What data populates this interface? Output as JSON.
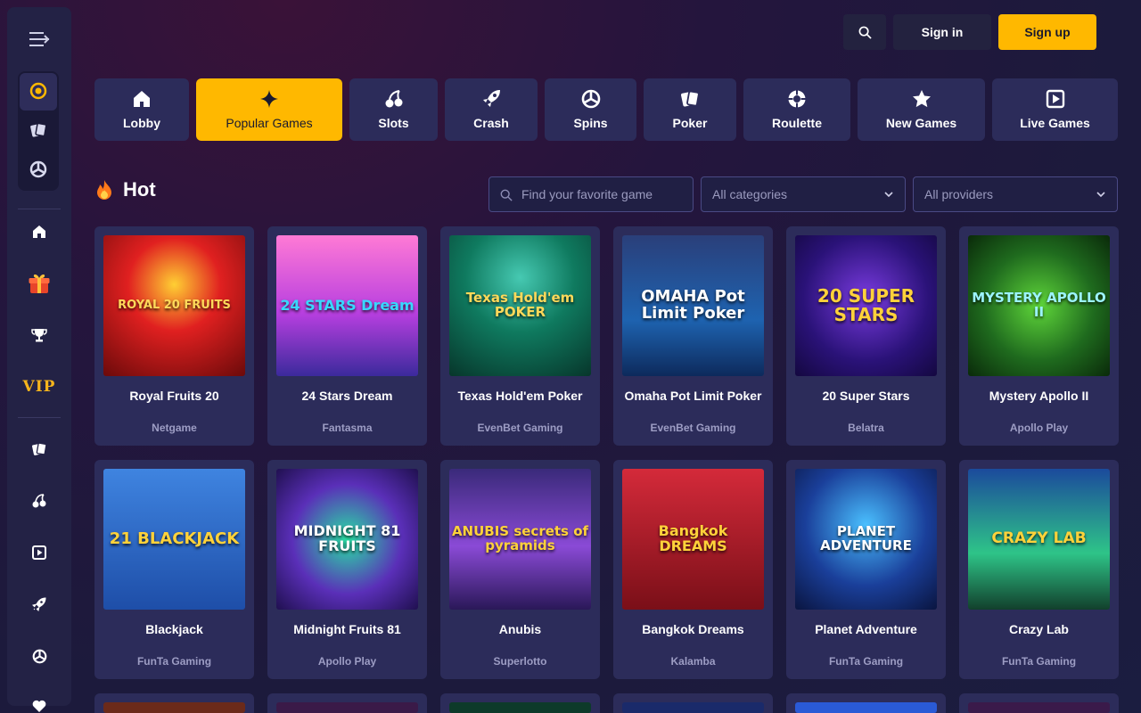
{
  "header": {
    "search_icon": "search-icon",
    "signin_label": "Sign in",
    "signup_label": "Sign up",
    "accent": "#ffb800"
  },
  "nav": [
    {
      "label": "Lobby",
      "icon": "home-icon"
    },
    {
      "label": "Popular Games",
      "icon": "sparkle-icon",
      "active": true
    },
    {
      "label": "Slots",
      "icon": "cherries-icon"
    },
    {
      "label": "Crash",
      "icon": "rocket-icon"
    },
    {
      "label": "Spins",
      "icon": "spin-icon"
    },
    {
      "label": "Poker",
      "icon": "cards-icon"
    },
    {
      "label": "Roulette",
      "icon": "roulette-icon"
    },
    {
      "label": "New Games",
      "icon": "star-icon"
    },
    {
      "label": "Live Games",
      "icon": "play-icon"
    }
  ],
  "sidebar": {
    "vip_label": "VIP",
    "items": [
      "menu-icon",
      "casino-chip-icon",
      "cards-icon",
      "spin-icon",
      "home-icon",
      "gift-icon",
      "trophy-icon",
      "vip-icon",
      "cards-icon",
      "cherries-icon",
      "play-icon",
      "rocket-icon",
      "spin-icon",
      "heart-icon"
    ]
  },
  "section": {
    "title": "Hot",
    "search_placeholder": "Find your favorite game",
    "category_select": "All categories",
    "provider_select": "All providers"
  },
  "games": [
    {
      "title": "Royal Fruits 20",
      "provider": "Netgame",
      "art": "ROYAL 20 FRUITS"
    },
    {
      "title": "24 Stars Dream",
      "provider": "Fantasma",
      "art": "24 STARS Dream"
    },
    {
      "title": "Texas Hold'em Poker",
      "provider": "EvenBet Gaming",
      "art": "Texas Hold'em POKER"
    },
    {
      "title": "Omaha Pot Limit Poker",
      "provider": "EvenBet Gaming",
      "art": "OMAHA Pot Limit Poker"
    },
    {
      "title": "20 Super Stars",
      "provider": "Belatra",
      "art": "20 SUPER STARS"
    },
    {
      "title": "Mystery Apollo II",
      "provider": "Apollo Play",
      "art": "MYSTERY APOLLO II"
    },
    {
      "title": "Blackjack",
      "provider": "FunTa Gaming",
      "art": "21 BLACKJACK"
    },
    {
      "title": "Midnight Fruits 81",
      "provider": "Apollo Play",
      "art": "MIDNIGHT 81 FRUITS"
    },
    {
      "title": "Anubis",
      "provider": "Superlotto",
      "art": "ANUBIS secrets of pyramids"
    },
    {
      "title": "Bangkok Dreams",
      "provider": "Kalamba",
      "art": "Bangkok DREAMS"
    },
    {
      "title": "Planet Adventure",
      "provider": "FunTa Gaming",
      "art": "PLANET ADVENTURE"
    },
    {
      "title": "Crazy Lab",
      "provider": "FunTa Gaming",
      "art": "CRAZY LAB"
    }
  ]
}
